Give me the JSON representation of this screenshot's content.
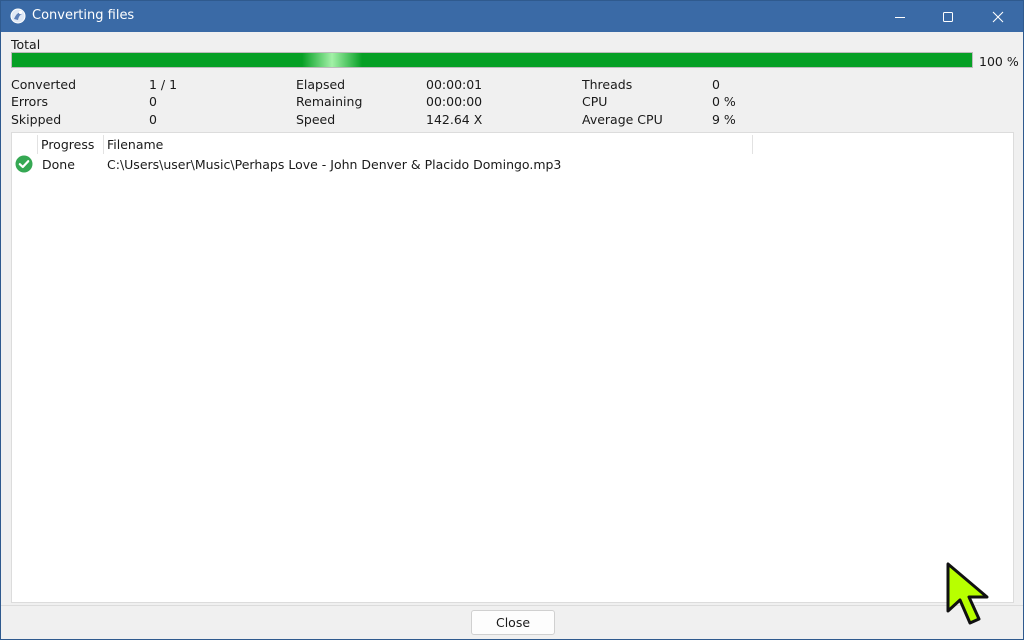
{
  "window": {
    "title": "Converting files",
    "accent_color": "#3a6aa6",
    "controls": [
      "minimize-icon",
      "maximize-icon",
      "close-icon"
    ]
  },
  "total": {
    "label": "Total",
    "progress_percent": 100,
    "progress_text": "100 %",
    "bar_color": "#06a025"
  },
  "stats": {
    "converted": {
      "label": "Converted",
      "value": "1 / 1"
    },
    "errors": {
      "label": "Errors",
      "value": "0"
    },
    "skipped": {
      "label": "Skipped",
      "value": "0"
    },
    "elapsed": {
      "label": "Elapsed",
      "value": "00:00:01"
    },
    "remaining": {
      "label": "Remaining",
      "value": "00:00:00"
    },
    "speed": {
      "label": "Speed",
      "value": "142.64 X"
    },
    "threads": {
      "label": "Threads",
      "value": "0"
    },
    "cpu": {
      "label": "CPU",
      "value": "0 %"
    },
    "avg_cpu": {
      "label": "Average CPU",
      "value": "9 %"
    }
  },
  "list": {
    "columns": [
      "Progress",
      "Filename"
    ],
    "rows": [
      {
        "status_icon": "check-circle-icon",
        "progress": "Done",
        "filename": "C:\\Users\\user\\Music\\Perhaps Love - John Denver & Placido Domingo.mp3"
      }
    ]
  },
  "buttons": {
    "close": "Close"
  },
  "cursor": {
    "icon": "mouse-pointer-icon",
    "color": "#b8ff00"
  }
}
